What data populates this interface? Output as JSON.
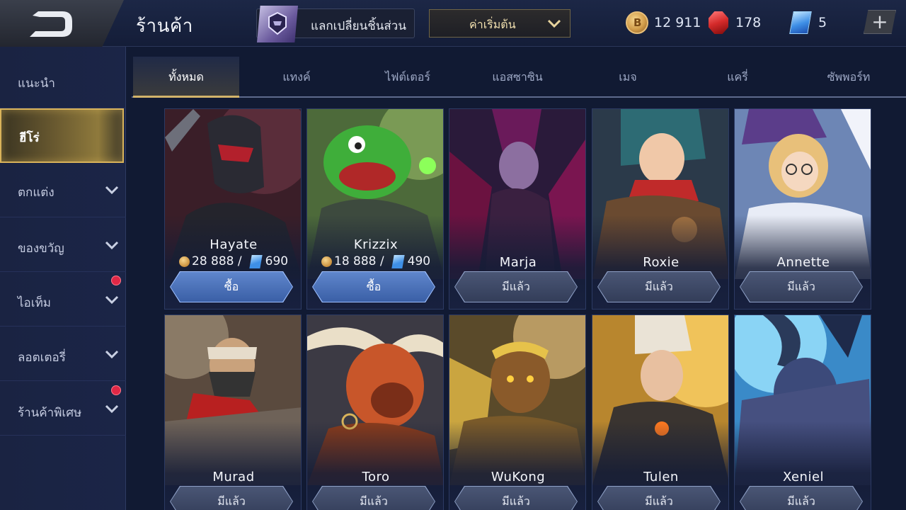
{
  "header": {
    "title": "ร้านค้า",
    "exchange_label": "แลกเปลี่ยนชิ้นส่วน",
    "sort_label": "ค่าเริ่มต้น",
    "gold": "12 911",
    "rubies": "178",
    "vouchers": "5",
    "add_label": "+"
  },
  "sidebar": {
    "items": [
      {
        "label": "แนะนำ"
      },
      {
        "label": "ฮีโร่"
      },
      {
        "label": "ตกแต่ง"
      },
      {
        "label": "ของขวัญ"
      },
      {
        "label": "ไอเท็ม"
      },
      {
        "label": "ลอตเตอรี่"
      },
      {
        "label": "ร้านค้าพิเศษ"
      }
    ]
  },
  "tabs": [
    {
      "label": "ทั้งหมด"
    },
    {
      "label": "แทงค์"
    },
    {
      "label": "ไฟต์เตอร์"
    },
    {
      "label": "แอสซาซิน"
    },
    {
      "label": "เมจ"
    },
    {
      "label": "แครี่"
    },
    {
      "label": "ซัพพอร์ท"
    }
  ],
  "heroes": [
    {
      "name": "Hayate",
      "gold_price": "28 888 /",
      "voucher_price": "690",
      "button": "ซื้อ"
    },
    {
      "name": "Krizzix",
      "gold_price": "18 888 /",
      "voucher_price": "490",
      "button": "ซื้อ"
    },
    {
      "name": "Marja",
      "button": "มีแล้ว"
    },
    {
      "name": "Roxie",
      "button": "มีแล้ว"
    },
    {
      "name": "Annette",
      "button": "มีแล้ว"
    },
    {
      "name": "Murad",
      "button": "มีแล้ว"
    },
    {
      "name": "Toro",
      "button": "มีแล้ว"
    },
    {
      "name": "WuKong",
      "button": "มีแล้ว"
    },
    {
      "name": "Tulen",
      "button": "มีแล้ว"
    },
    {
      "name": "Xeniel",
      "button": "มีแล้ว"
    }
  ],
  "colors": {
    "accent_gold": "#d9b35a",
    "buy_button": "#4a6fb8",
    "owned_button": "#3c4766",
    "notification_dot": "#e02846"
  }
}
